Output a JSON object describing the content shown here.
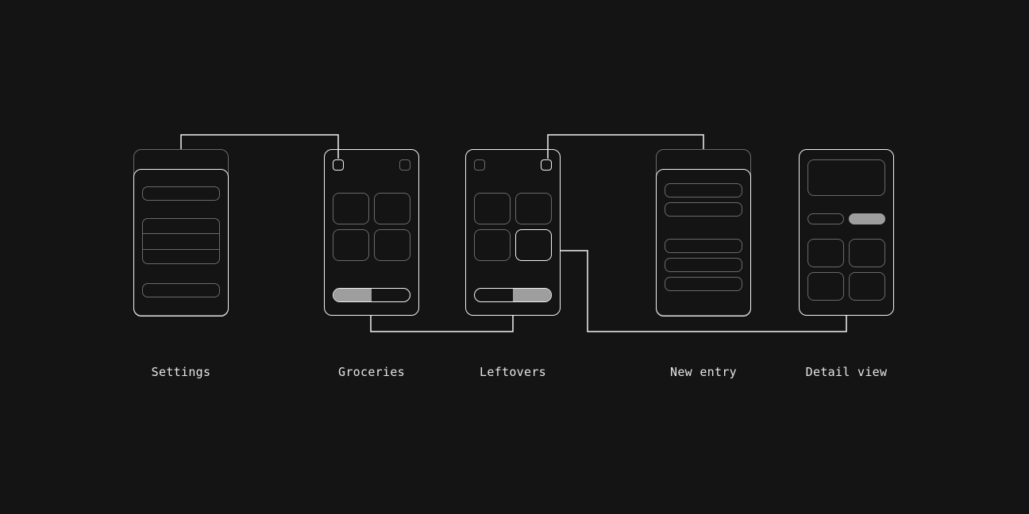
{
  "screens": [
    {
      "id": "settings",
      "label": "Settings"
    },
    {
      "id": "groceries",
      "label": "Groceries"
    },
    {
      "id": "leftovers",
      "label": "Leftovers"
    },
    {
      "id": "new-entry",
      "label": "New entry"
    },
    {
      "id": "detail-view",
      "label": "Detail view"
    }
  ]
}
